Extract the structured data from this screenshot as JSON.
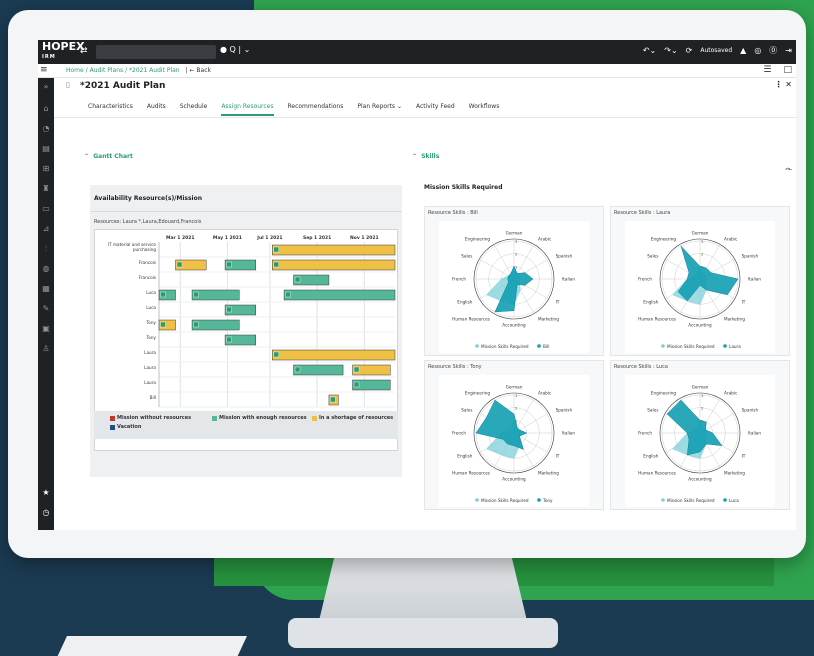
{
  "app": {
    "logo_text": "HOPEX",
    "logo_sub": "IRM",
    "autosave": "Autosaved"
  },
  "breadcrumb": {
    "home": "Home",
    "sep": "/",
    "plans": "Audit Plans",
    "current": "*2021 Audit Plan",
    "back": "Back"
  },
  "page": {
    "title": "*2021 Audit Plan"
  },
  "tabs": [
    {
      "label": "Characteristics"
    },
    {
      "label": "Audits"
    },
    {
      "label": "Schedule"
    },
    {
      "label": "Assign Resources"
    },
    {
      "label": "Recommendations"
    },
    {
      "label": "Plan Reports"
    },
    {
      "label": "Activity Feed"
    },
    {
      "label": "Workflows"
    }
  ],
  "gantt_section": {
    "header": "Gantt Chart",
    "title": "Availability Resource(s)/Mission",
    "resources_label": "Resources: Laura *,Laura,Edouard,Francois"
  },
  "skills_section": {
    "header": "Skills",
    "subtitle": "Mission Skills Required"
  },
  "legend": {
    "without": "Mission without resources",
    "enough": "Mission with enough resources",
    "shortage": "In a shortage of resources",
    "vacation": "Vacation"
  },
  "colors": {
    "green": "#2a9d6e",
    "teal": "#129fb3",
    "teal_light": "#7fcfd9",
    "gold": "#f0bf45",
    "gantt_green": "#55b79a"
  },
  "chart_data": [
    {
      "type": "gantt",
      "title": "Availability Resource(s)/Mission",
      "x_ticks": [
        "Mar 1 2021",
        "May 1 2021",
        "Jul 1 2021",
        "Sep 1 2021",
        "Nov 1 2021"
      ],
      "rows": [
        "IT material and service purchasing",
        "Francois",
        "Francois",
        "Luca",
        "Luca",
        "Tony",
        "Tony",
        "Laura",
        "Laura",
        "Laura",
        "Bill"
      ],
      "bars": [
        {
          "row": 0,
          "start": 0.48,
          "end": 1.0,
          "kind": "shortage"
        },
        {
          "row": 1,
          "start": 0.07,
          "end": 0.2,
          "kind": "shortage"
        },
        {
          "row": 1,
          "start": 0.28,
          "end": 0.41,
          "kind": "enough"
        },
        {
          "row": 1,
          "start": 0.48,
          "end": 1.0,
          "kind": "shortage"
        },
        {
          "row": 2,
          "start": 0.57,
          "end": 0.72,
          "kind": "enough"
        },
        {
          "row": 3,
          "start": 0.0,
          "end": 0.07,
          "kind": "enough"
        },
        {
          "row": 3,
          "start": 0.14,
          "end": 0.34,
          "kind": "enough"
        },
        {
          "row": 3,
          "start": 0.53,
          "end": 1.0,
          "kind": "enough"
        },
        {
          "row": 4,
          "start": 0.28,
          "end": 0.41,
          "kind": "enough"
        },
        {
          "row": 5,
          "start": 0.0,
          "end": 0.07,
          "kind": "shortage"
        },
        {
          "row": 5,
          "start": 0.14,
          "end": 0.34,
          "kind": "enough"
        },
        {
          "row": 6,
          "start": 0.28,
          "end": 0.41,
          "kind": "enough"
        },
        {
          "row": 7,
          "start": 0.48,
          "end": 1.0,
          "kind": "shortage"
        },
        {
          "row": 8,
          "start": 0.57,
          "end": 0.78,
          "kind": "enough"
        },
        {
          "row": 8,
          "start": 0.82,
          "end": 0.98,
          "kind": "shortage"
        },
        {
          "row": 9,
          "start": 0.82,
          "end": 0.98,
          "kind": "enough"
        },
        {
          "row": 10,
          "start": 0.72,
          "end": 0.76,
          "kind": "shortage"
        }
      ]
    },
    {
      "type": "radar",
      "axes": [
        "German",
        "Arabic",
        "Spanish",
        "Italian",
        "IT",
        "Marketing",
        "Accounting",
        "Human Resources",
        "English",
        "French",
        "Sales",
        "Engineering"
      ],
      "rings": [
        "1",
        "2",
        "3"
      ],
      "series_required": "Mission Skills Required",
      "charts": [
        {
          "title": "Resource Skills : Bill",
          "resource": "Bill",
          "required": [
            1,
            0.5,
            0.5,
            0.5,
            0.5,
            1,
            2,
            2,
            2.5,
            1,
            0.5,
            0.5
          ],
          "resource_values": [
            1,
            0.5,
            1,
            1.5,
            1,
            0.5,
            2.5,
            3,
            0.5,
            0.5,
            0.5,
            0.5
          ]
        },
        {
          "title": "Resource Skills : Laura",
          "resource": "Laura",
          "required": [
            1,
            0.5,
            0.5,
            0.5,
            0.5,
            1,
            2,
            2,
            2.5,
            1,
            0.5,
            0.5
          ],
          "resource_values": [
            1,
            1,
            1,
            3,
            2.5,
            1,
            0.5,
            2,
            2,
            1,
            1,
            3
          ]
        },
        {
          "title": "Resource Skills : Tony",
          "resource": "Tony",
          "required": [
            1,
            0.5,
            0.5,
            0.5,
            0.5,
            1,
            2,
            2,
            2.5,
            1,
            0.5,
            0.5
          ],
          "resource_values": [
            1.5,
            0.5,
            0.5,
            1,
            0.5,
            1.5,
            1,
            1,
            1,
            3,
            2.5,
            3
          ]
        },
        {
          "title": "Resource Skills : Luca",
          "resource": "Luca",
          "required": [
            1,
            0.5,
            0.5,
            0.5,
            0.5,
            1,
            2,
            2,
            2.5,
            1,
            0.5,
            0.5
          ],
          "resource_values": [
            1,
            1,
            0.5,
            1,
            2,
            1,
            1.5,
            2,
            1,
            1,
            3,
            3
          ]
        }
      ]
    }
  ]
}
